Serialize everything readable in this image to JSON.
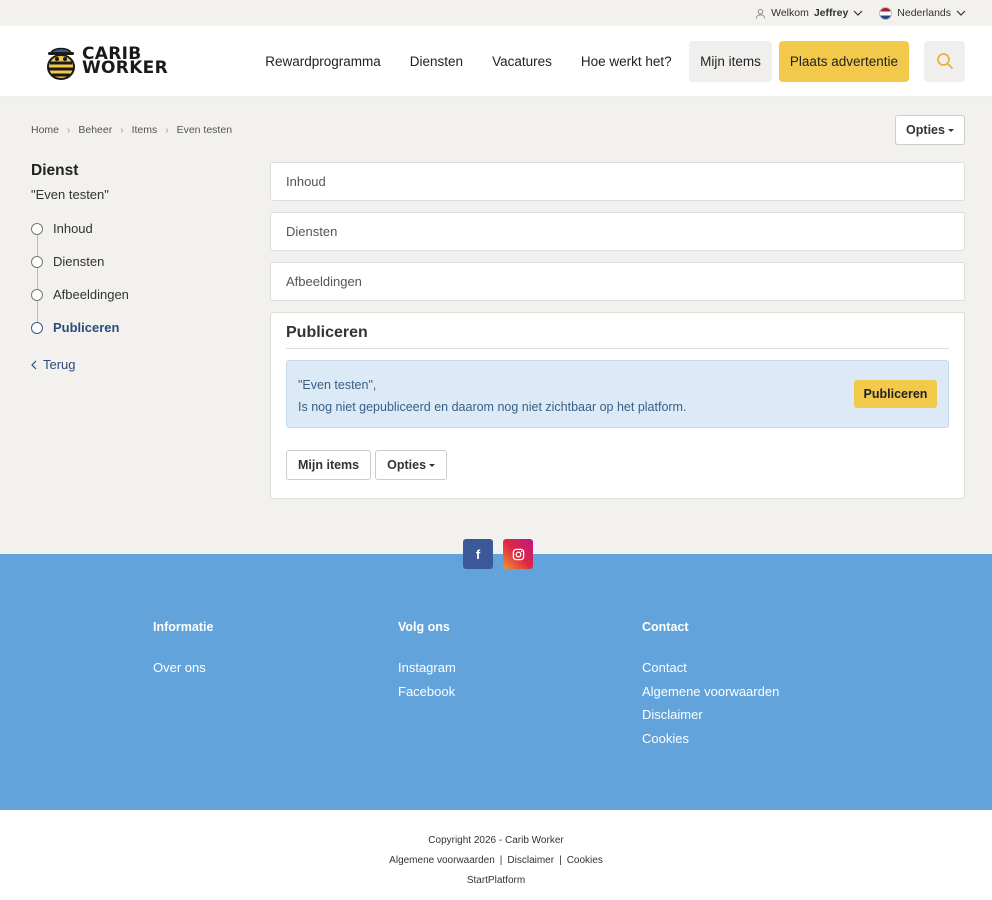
{
  "topbar": {
    "welcome_prefix": "Welkom",
    "user_name": "Jeffrey",
    "language": "Nederlands"
  },
  "logo": {
    "line1": "CARIB",
    "line2": "WORKER"
  },
  "nav": {
    "links": [
      "Rewardprogramma",
      "Diensten",
      "Vacatures",
      "Hoe werkt het?"
    ],
    "my_items": "Mijn items",
    "place_ad": "Plaats advertentie"
  },
  "breadcrumb": [
    "Home",
    "Beheer",
    "Items",
    "Even testen"
  ],
  "options_label": "Opties",
  "sidebar": {
    "title": "Dienst",
    "subtitle": "\"Even testen\"",
    "steps": [
      "Inhoud",
      "Diensten",
      "Afbeeldingen",
      "Publiceren"
    ],
    "back": "Terug"
  },
  "sections": [
    "Inhoud",
    "Diensten",
    "Afbeeldingen"
  ],
  "publish_panel": {
    "title": "Publiceren",
    "line1": "\"Even testen\",",
    "line2": "Is nog niet gepubliceerd en daarom nog niet zichtbaar op het platform.",
    "button": "Publiceren",
    "my_items": "Mijn items",
    "options": "Opties"
  },
  "footer": {
    "col1": {
      "heading": "Informatie",
      "links": [
        "Over ons"
      ]
    },
    "col2": {
      "heading": "Volg ons",
      "links": [
        "Instagram",
        "Facebook"
      ]
    },
    "col3": {
      "heading": "Contact",
      "links": [
        "Contact",
        "Algemene voorwaarden",
        "Disclaimer",
        "Cookies"
      ]
    }
  },
  "bottom": {
    "copyright": "Copyright 2026 - Carib Worker",
    "links": [
      "Algemene voorwaarden",
      "Disclaimer",
      "Cookies"
    ],
    "platform": "StartPlatform"
  },
  "colors": {
    "accent_yellow": "#f3c94c",
    "footer_blue": "#62a3db",
    "link_blue": "#2c4a7c"
  }
}
